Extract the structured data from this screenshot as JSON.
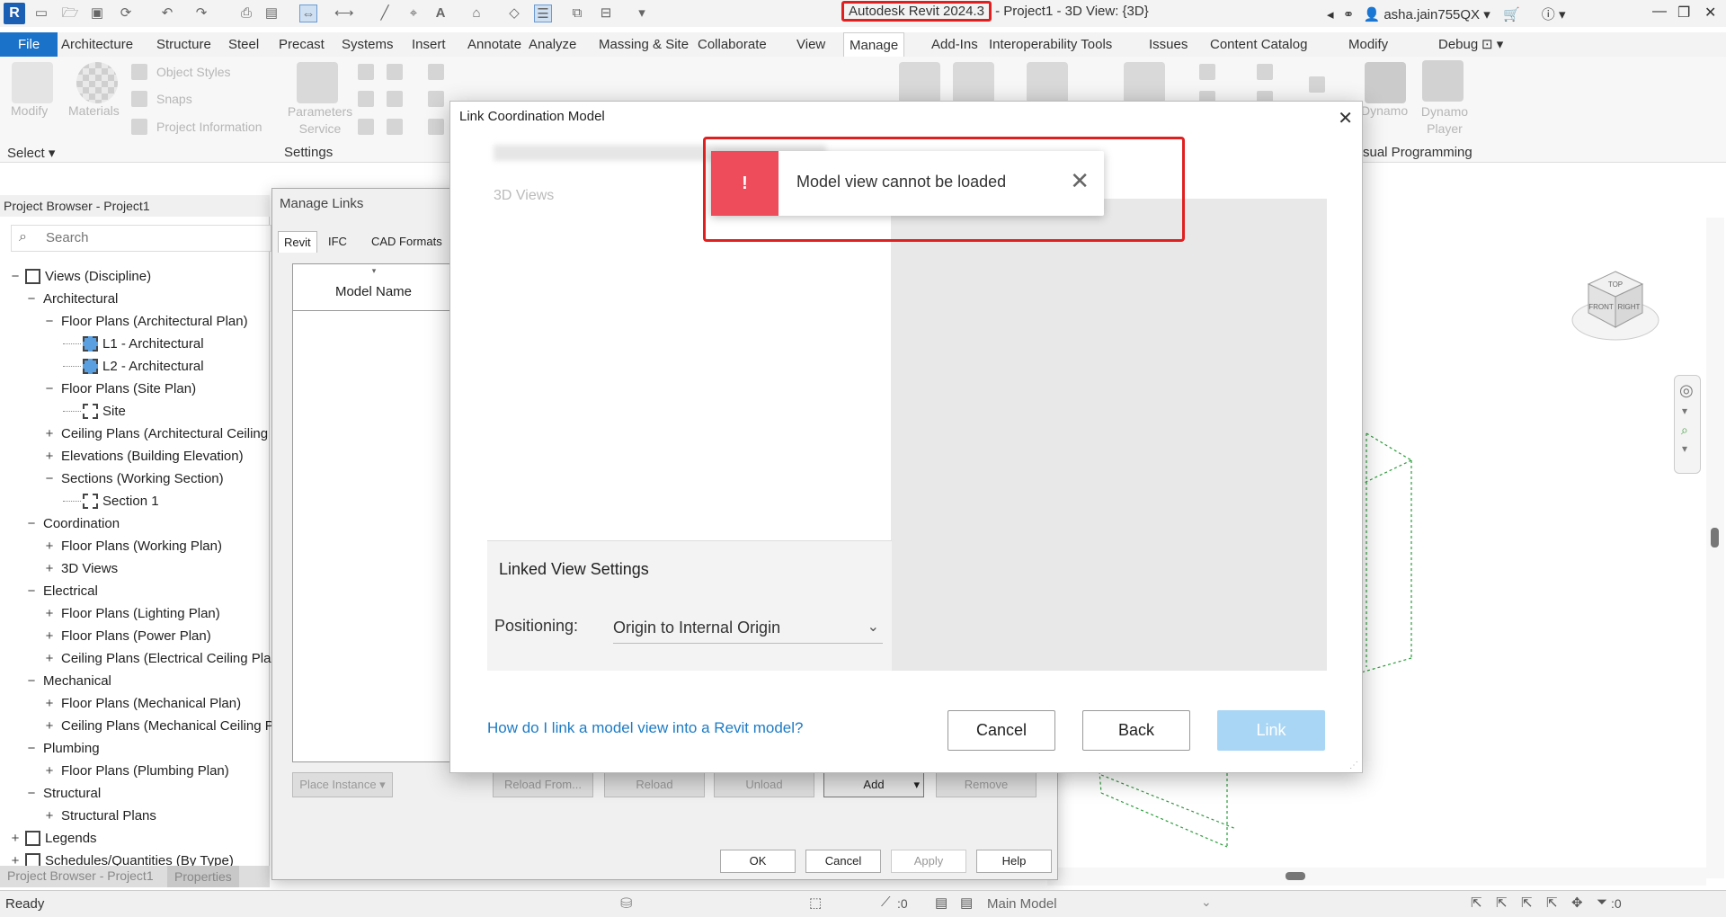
{
  "app": {
    "title_version": "Autodesk Revit 2024.3",
    "title_suffix": "- Project1 - 3D View: {3D}",
    "user": "asha.jain755QX",
    "logo": "R"
  },
  "tabs": [
    "File",
    "Architecture",
    "Structure",
    "Steel",
    "Precast",
    "Systems",
    "Insert",
    "Annotate",
    "Analyze",
    "Massing & Site",
    "Collaborate",
    "View",
    "Manage",
    "Add-Ins",
    "Interoperability Tools",
    "Issues",
    "Content Catalog",
    "Modify",
    "Debug"
  ],
  "active_tab": "Manage",
  "ribbon": {
    "modify": "Modify",
    "materials": "Materials",
    "object_styles": "Object  Styles",
    "snaps": "Snaps",
    "project_information": "Project  Information",
    "parameters_service": "Parameters Service",
    "dynamo": "Dynamo",
    "dynamo_player": "Dynamo Player",
    "panel_select": "Select",
    "panel_settings": "Settings",
    "panel_visual_programming": "sual Programming"
  },
  "project_browser": {
    "header": "Project Browser - Project1",
    "search_placeholder": "Search",
    "bottom_tab_1": "Project Browser - Project1",
    "bottom_tab_2": "Properties",
    "tree": [
      {
        "label": "Views (Discipline)",
        "level": 0,
        "toggle": "−",
        "icon": "views"
      },
      {
        "label": "Architectural",
        "level": 1,
        "toggle": "−"
      },
      {
        "label": "Floor Plans (Architectural Plan)",
        "level": 2,
        "toggle": "−"
      },
      {
        "label": "L1 - Architectural",
        "level": 3,
        "icon": "plan"
      },
      {
        "label": "L2 - Architectural",
        "level": 3,
        "icon": "plan"
      },
      {
        "label": "Floor Plans (Site Plan)",
        "level": 2,
        "toggle": "−"
      },
      {
        "label": "Site",
        "level": 3,
        "icon": "view"
      },
      {
        "label": "Ceiling Plans (Architectural Ceiling P",
        "level": 2,
        "toggle": "+"
      },
      {
        "label": "Elevations (Building Elevation)",
        "level": 2,
        "toggle": "+"
      },
      {
        "label": "Sections (Working Section)",
        "level": 2,
        "toggle": "−"
      },
      {
        "label": "Section 1",
        "level": 3,
        "icon": "view"
      },
      {
        "label": "Coordination",
        "level": 1,
        "toggle": "−"
      },
      {
        "label": "Floor Plans (Working Plan)",
        "level": 2,
        "toggle": "+"
      },
      {
        "label": "3D Views",
        "level": 2,
        "toggle": "+"
      },
      {
        "label": "Electrical",
        "level": 1,
        "toggle": "−"
      },
      {
        "label": "Floor Plans (Lighting Plan)",
        "level": 2,
        "toggle": "+"
      },
      {
        "label": "Floor Plans (Power Plan)",
        "level": 2,
        "toggle": "+"
      },
      {
        "label": "Ceiling Plans (Electrical Ceiling Plan",
        "level": 2,
        "toggle": "+"
      },
      {
        "label": "Mechanical",
        "level": 1,
        "toggle": "−"
      },
      {
        "label": "Floor Plans (Mechanical Plan)",
        "level": 2,
        "toggle": "+"
      },
      {
        "label": "Ceiling Plans (Mechanical Ceiling Pl",
        "level": 2,
        "toggle": "+"
      },
      {
        "label": "Plumbing",
        "level": 1,
        "toggle": "−"
      },
      {
        "label": "Floor Plans (Plumbing Plan)",
        "level": 2,
        "toggle": "+"
      },
      {
        "label": "Structural",
        "level": 1,
        "toggle": "−"
      },
      {
        "label": "Structural Plans",
        "level": 2,
        "toggle": "+"
      },
      {
        "label": "Legends",
        "level": 0,
        "toggle": "+",
        "icon": "legend"
      },
      {
        "label": "Schedules/Quantities (By Type)",
        "level": 0,
        "toggle": "+",
        "icon": "schedule"
      }
    ]
  },
  "manage_links": {
    "title": "Manage Links",
    "tabs": [
      "Revit",
      "IFC",
      "CAD Formats"
    ],
    "col_model_name": "Model Name",
    "place_instance": "Place Instance",
    "reload_from": "Reload From...",
    "reload": "Reload",
    "unload": "Unload",
    "add": "Add",
    "remove": "Remove",
    "ok": "OK",
    "cancel": "Cancel",
    "apply": "Apply",
    "help": "Help"
  },
  "link_coordination": {
    "title": "Link Coordination Model",
    "list_header": "3D Views",
    "settings_title": "Linked View Settings",
    "positioning_label": "Positioning:",
    "positioning_value": "Origin to Internal Origin",
    "help_link": "How do I link a model view into a Revit model?",
    "cancel": "Cancel",
    "back": "Back",
    "link": "Link"
  },
  "error_toast": {
    "icon": "!",
    "message": "Model view cannot be loaded"
  },
  "status": {
    "ready": "Ready",
    "zero1": ":0",
    "main_model": "Main Model",
    "filter_count": ":0"
  },
  "viewcube": {
    "top": "TOP",
    "front": "FRONT",
    "right": "RIGHT"
  },
  "colors": {
    "accent": "#1b72c9",
    "error": "#ee4b5b",
    "highlight": "#e02020",
    "link_button": "#a9d6f5"
  }
}
